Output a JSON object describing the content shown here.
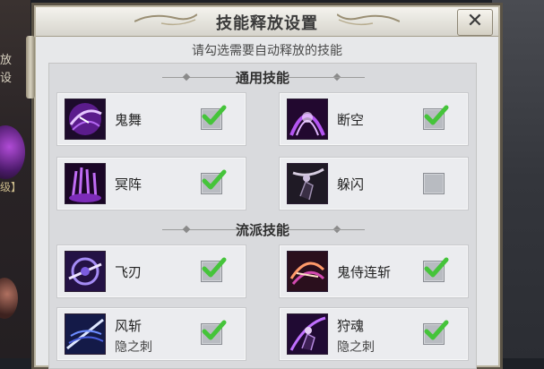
{
  "dialog": {
    "title": "技能释放设置",
    "close_label": "✕",
    "subtitle": "请勾选需要自动释放的技能"
  },
  "background": {
    "fragment_top": "放设",
    "fragment_mid": "级】"
  },
  "sections": [
    {
      "title": "通用技能",
      "skills": [
        {
          "name": "鬼舞",
          "sub": "",
          "checked": true,
          "icon": "ghost-dance-icon"
        },
        {
          "name": "断空",
          "sub": "",
          "checked": true,
          "icon": "break-sky-icon"
        },
        {
          "name": "冥阵",
          "sub": "",
          "checked": true,
          "icon": "nether-array-icon"
        },
        {
          "name": "躲闪",
          "sub": "",
          "checked": false,
          "icon": "dodge-icon"
        }
      ]
    },
    {
      "title": "流派技能",
      "skills": [
        {
          "name": "飞刃",
          "sub": "",
          "checked": true,
          "icon": "flying-blade-icon"
        },
        {
          "name": "鬼侍连斩",
          "sub": "",
          "checked": true,
          "icon": "ghost-combo-icon"
        },
        {
          "name": "风斩",
          "sub": "隐之刺",
          "checked": true,
          "icon": "wind-slash-icon"
        },
        {
          "name": "狩魂",
          "sub": "隐之刺",
          "checked": true,
          "icon": "soul-hunt-icon"
        }
      ]
    }
  ],
  "colors": {
    "check": "#45c43a",
    "icon_purple": "#8b2fc9",
    "panel": "#d9dadd"
  }
}
